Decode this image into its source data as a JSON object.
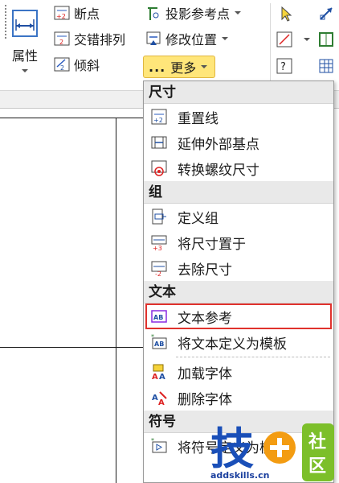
{
  "ribbon": {
    "properties_label": "属性",
    "col2": [
      "断点",
      "交错排列",
      "倾斜"
    ],
    "col3": [
      "投影参考点",
      "修改位置"
    ],
    "more_label": "更多"
  },
  "menu": {
    "sections": [
      {
        "title": "尺寸",
        "items": [
          "重置线",
          "延伸外部基点",
          "转换螺纹尺寸"
        ]
      },
      {
        "title": "组",
        "items": [
          "定义组",
          "将尺寸置于",
          "去除尺寸"
        ]
      },
      {
        "title": "文本",
        "items": [
          "文本参考",
          "将文本定义为模板",
          "加载字体",
          "删除字体"
        ]
      },
      {
        "title": "符号",
        "items": [
          "将符号定义为模板"
        ]
      }
    ]
  },
  "watermark": {
    "char1": "技",
    "char2": "社",
    "char3": "区",
    "url": "addskills.cn"
  }
}
